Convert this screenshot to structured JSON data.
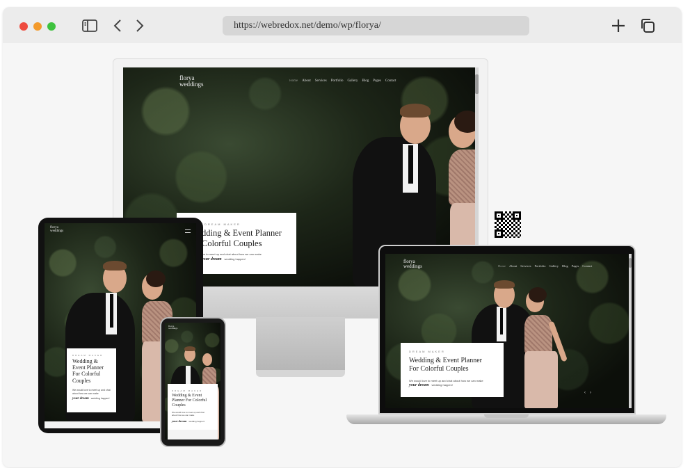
{
  "browser": {
    "url": "https://webredox.net/demo/wp/florya/",
    "icons": {
      "sidebar": "sidebar-icon",
      "back": "chevron-left-icon",
      "forward": "chevron-right-icon",
      "new_tab": "plus-icon",
      "tabs": "copy-icon"
    }
  },
  "site": {
    "logo_line1": "florya",
    "logo_line2": "weddings",
    "nav": [
      "Home",
      "About",
      "Services",
      "Portfolio",
      "Gallery",
      "Blog",
      "Pages",
      "Contact"
    ],
    "hero": {
      "eyebrow": "DREAM MAKER",
      "title_line1": "Wedding & Event Planner",
      "title_line2": "For Colorful Couples",
      "desktop_title_line1": "dding & Event Planner",
      "desktop_title_line2": "Colorful Couples",
      "desktop_text": "we to meet up and chat about how we can make",
      "tablet_title_line1": "Wedding &",
      "tablet_title_line2": "Event Planner",
      "tablet_title_line3": "For Colorful",
      "tablet_title_line4": "Couples",
      "phone_title_line1": "Wedding & Event",
      "phone_title_line2": "Planner For Colorful",
      "phone_title_line3": "Couples",
      "text": "We would love to meet up and chat about how we can make",
      "tablet_text_1": "We would love to meet up and chat",
      "tablet_text_2": "about how we can make",
      "script": "your dream",
      "tail": "wedding happen!"
    }
  },
  "colors": {
    "window_bg": "#f6f6f6",
    "toolbar_bg": "#ececec",
    "traffic_red": "#ee4b3e",
    "traffic_orange": "#f39a2b",
    "traffic_green": "#3ec23e"
  }
}
